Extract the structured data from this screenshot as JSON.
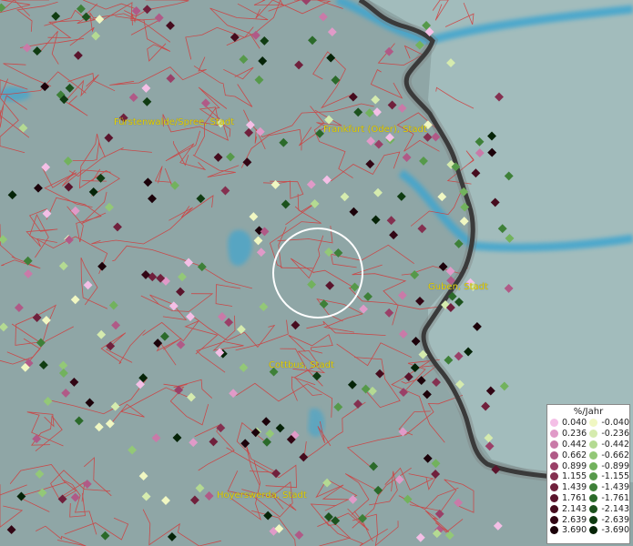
{
  "map": {
    "cities": [
      {
        "name": "Fürstenwalde/Spree, Stadt"
      },
      {
        "name": "Frankfurt (Oder), Stadt"
      },
      {
        "name": "Guben, Stadt"
      },
      {
        "name": "Cottbus, Stadt"
      },
      {
        "name": "Hoyerswerda, Stadt"
      }
    ]
  },
  "legend": {
    "title": "%/Jahr",
    "positive": [
      {
        "label": "0.040",
        "color": "#f4bfe6"
      },
      {
        "label": "0.236",
        "color": "#e09ac8"
      },
      {
        "label": "0.442",
        "color": "#c97aa8"
      },
      {
        "label": "0.662",
        "color": "#b05a87"
      },
      {
        "label": "0.899",
        "color": "#9a4068"
      },
      {
        "label": "1.155",
        "color": "#843050"
      },
      {
        "label": "1.439",
        "color": "#70203c"
      },
      {
        "label": "1.761",
        "color": "#5a142c"
      },
      {
        "label": "2.143",
        "color": "#460c1e"
      },
      {
        "label": "2.639",
        "color": "#320614"
      },
      {
        "label": "3.690",
        "color": "#1c020a"
      }
    ],
    "negative": [
      {
        "label": "-0.040",
        "color": "#f0f7c2"
      },
      {
        "label": "-0.236",
        "color": "#d5ebae"
      },
      {
        "label": "-0.442",
        "color": "#b4da92"
      },
      {
        "label": "-0.662",
        "color": "#93c877"
      },
      {
        "label": "-0.899",
        "color": "#72b25d"
      },
      {
        "label": "-1.155",
        "color": "#56994a"
      },
      {
        "label": "-1.439",
        "color": "#3e8038"
      },
      {
        "label": "-1.761",
        "color": "#2b6a2a"
      },
      {
        "label": "-2.143",
        "color": "#1c521d"
      },
      {
        "label": "-2.639",
        "color": "#103c12"
      },
      {
        "label": "-3.690",
        "color": "#062408"
      }
    ]
  }
}
